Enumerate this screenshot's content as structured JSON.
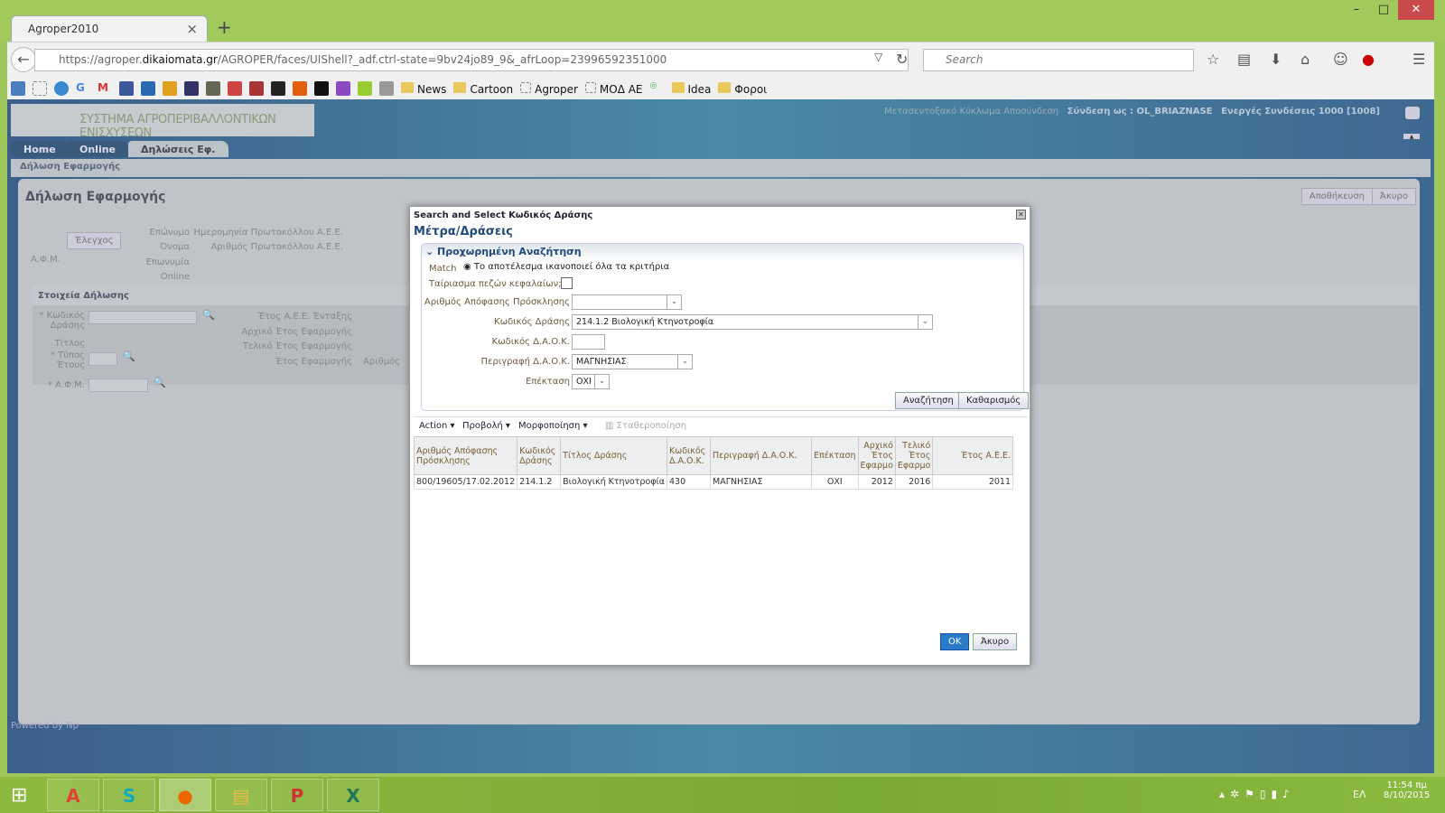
{
  "browser": {
    "tab_title": "Agroper2010",
    "url_pre": "https://agroper.",
    "url_domain": "dikaiomata.gr",
    "url_post": "/AGROPER/faces/UIShell?_adf.ctrl-state=9bv24jo89_9&_afrLoop=23996592351000",
    "search_placeholder": "Search",
    "bookmarks": [
      "News",
      "Cartoon",
      "Agroper",
      "ΜΟΔ ΑΕ",
      "Idea",
      "Φοροι"
    ]
  },
  "app": {
    "logo_text": "ΣΥΣΤΗΜΑ ΑΓΡΟΠΕΡΙΒΑΛΛΟΝΤΙΚΩΝ ΕΝΙΣΧΥΣΕΩΝ",
    "top_links": "Μετασεντοξακό Κύκλωμα Αποσύνδεση",
    "login": "Σύνδεση ως : OL_BRIAZNASE",
    "sessions": "Ενεργές Συνδέσεις 1000 [1008]",
    "nav_tabs": [
      "Home",
      "Online",
      "Δηλώσεις Εφ."
    ],
    "breadcrumb": "Δήλωση Εφαρμογής",
    "page_title": "Δήλωση Εφαρμογής",
    "save": "Αποθήκευση",
    "cancel": "Άκυρο",
    "check_btn": "Έλεγχος",
    "labels": {
      "afm": "Α.Φ.Μ.",
      "surname": "Επώνυμο",
      "name": "Όνομα",
      "company": "Επωνυμία",
      "online": "Online",
      "prot_date": "Ημερομηνία Πρωτοκόλλου Α.Ε.Ε.",
      "prot_num": "Αριθμός Πρωτοκόλλου Α.Ε.Ε.",
      "section": "Στοιχεία Δήλωσης",
      "action_code": "* Κωδικός Δράσης",
      "title": "Τίτλος",
      "year_type": "* Τύπος Έτους",
      "afm2": "* Α.Φ.Μ.",
      "year_entry": "Έτος Α.Ε.Ε. Ένταξης",
      "start_year": "Αρχικό Έτος Εφαρμογής",
      "end_year": "Τελικό Έτος Εφαρμογής",
      "app_year": "Έτος Εφαρμογής",
      "number": "Αριθμός"
    },
    "footer": "Powered by Np"
  },
  "dialog": {
    "title": "Search and Select Κωδικός Δράσης",
    "heading": "Μέτρα/Δράσεις",
    "adv_search": "Προχωρημένη Αναζήτηση",
    "match_label": "Match",
    "match_option": "Το αποτέλεσμα ικανοποιεί όλα τα κριτήρια",
    "case_label": "Ταίριασμα πεζών κεφαλαίων;",
    "fields": {
      "decision_label": "Αριθμός Απόφασης Πρόσκλησης",
      "decision_value": "",
      "action_label": "Κωδικός Δράσης",
      "action_value": "214.1.2 Βιολογική Κτηνοτροφία",
      "daok_label": "Κωδικός Δ.Α.Ο.Κ.",
      "daok_value": "",
      "daok_desc_label": "Περιγραφή Δ.Α.Ο.Κ.",
      "daok_desc_value": "ΜΑΓΝΗΣΙΑΣ",
      "ext_label": "Επέκταση",
      "ext_value": "ΟΧΙ"
    },
    "search_btn": "Αναζήτηση",
    "reset_btn": "Καθαρισμός",
    "toolbar": {
      "action": "Action ▾",
      "view": "Προβολή ▾",
      "format": "Μορφοποίηση ▾",
      "freeze": "Σταθεροποίηση"
    },
    "columns": [
      "Αριθμός Απόφασης Πρόσκλησης",
      "Κωδικός Δράσης",
      "Τίτλος Δράσης",
      "Κωδικός Δ.Α.Ο.Κ.",
      "Περιγραφή Δ.Α.Ο.Κ.",
      "Επέκταση",
      "Αρχικό Έτος Εφαρμο",
      "Τελικό Έτος Εφαρμο",
      "Έτος Α.Ε.Ε."
    ],
    "rows": [
      [
        "800/19605/17.02.2012",
        "214.1.2",
        "Βιολογική Κτηνοτροφία",
        "430",
        "ΜΑΓΝΗΣΙΑΣ",
        "ΟΧΙ",
        "2012",
        "2016",
        "2011"
      ]
    ],
    "ok": "OK",
    "cancel": "Άκυρο"
  },
  "taskbar": {
    "lang": "ΕΛ",
    "time": "11:54 πμ",
    "date": "8/10/2015"
  }
}
